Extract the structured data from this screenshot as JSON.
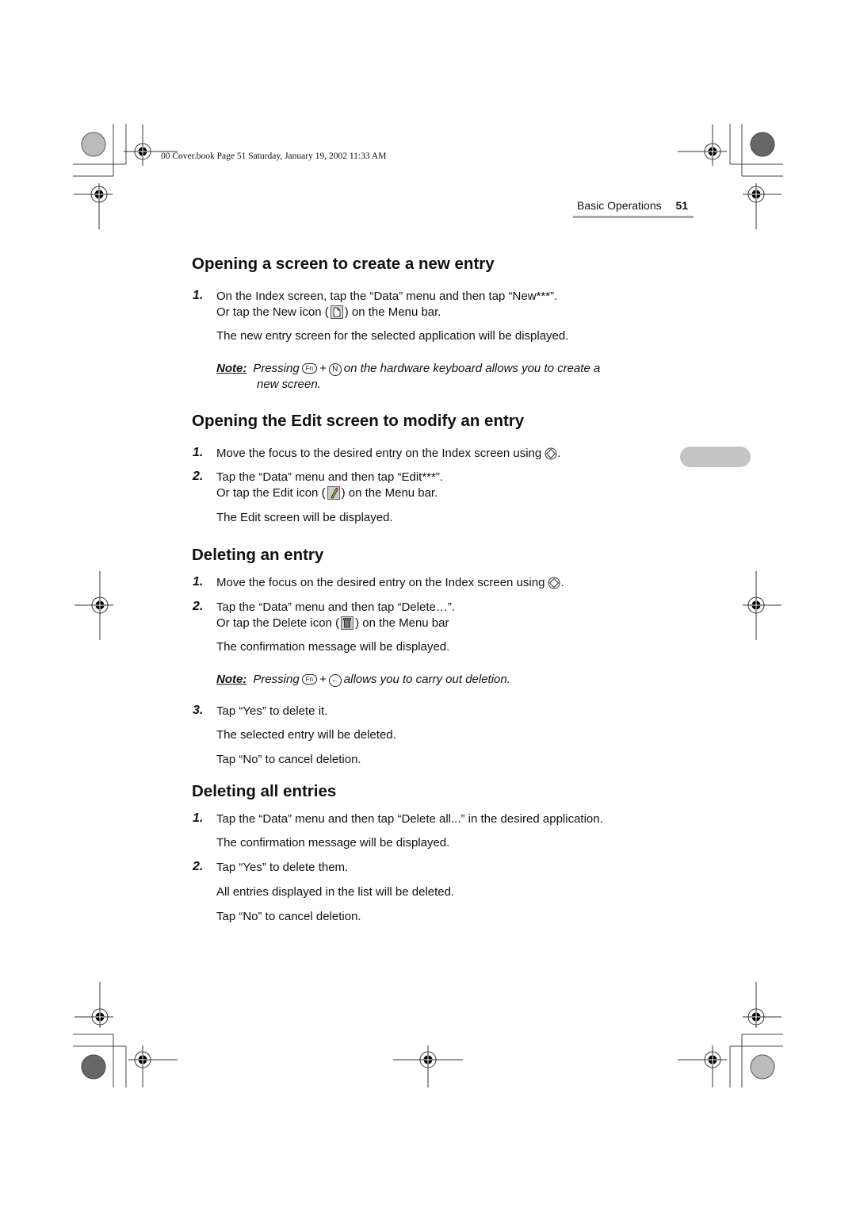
{
  "slug": "00 Cover.book  Page 51  Saturday, January 19, 2002  11:33 AM",
  "running_head": {
    "title": "Basic Operations",
    "page_number": "51"
  },
  "sections": [
    {
      "heading": "Opening a screen to create a new entry",
      "steps": [
        {
          "num": "1.",
          "line1": "On the Index screen, tap the “Data” menu and then tap “New***”.",
          "line2_before": "Or tap the New icon (",
          "line2_after": ") on the Menu bar.",
          "icon": "new-document-icon"
        }
      ],
      "result": "The new entry screen for the selected application will be displayed.",
      "note": {
        "label": "Note:",
        "before": "Pressing",
        "key1": "Fn",
        "plus": "+",
        "key2": "N",
        "after": "on the hardware keyboard allows you to create a",
        "cont": "new screen."
      }
    },
    {
      "heading": "Opening the Edit screen to modify an entry",
      "steps": [
        {
          "num": "1.",
          "line1": "Move the focus to the desired entry on the Index screen using",
          "end": "."
        },
        {
          "num": "2.",
          "line1": "Tap the “Data” menu and then tap “Edit***”.",
          "line2_before": "Or tap the Edit icon (",
          "line2_after": ") on the Menu bar.",
          "icon": "edit-pencil-icon"
        }
      ],
      "result": "The Edit screen will be displayed."
    },
    {
      "heading": "Deleting an entry",
      "steps": [
        {
          "num": "1.",
          "line1": "Move the focus on the desired entry on the Index screen using",
          "end": "."
        },
        {
          "num": "2.",
          "line1": "Tap the “Data” menu and then tap “Delete…”.",
          "line2_before": "Or tap the Delete icon (",
          "line2_after": ") on the Menu bar",
          "icon": "trash-icon"
        },
        {
          "num": "3.",
          "line1": "Tap “Yes” to delete it."
        }
      ],
      "result": "The confirmation message will be displayed.",
      "note": {
        "label": "Note:",
        "before": "Pressing",
        "key1": "Fn",
        "plus": "+",
        "after": "allows you to carry out deletion."
      },
      "after_step3": [
        "The selected entry will be deleted.",
        "Tap “No” to cancel deletion."
      ]
    },
    {
      "heading": "Deleting all entries",
      "steps": [
        {
          "num": "1.",
          "line1": "Tap the “Data” menu and then tap “Delete all...” in the desired application."
        },
        {
          "num": "2.",
          "line1": "Tap “Yes” to delete them."
        }
      ],
      "after_step1": "The confirmation message will be displayed.",
      "after_step2": [
        "All entries displayed in the list will be deleted.",
        "Tap “No” to cancel deletion."
      ]
    }
  ]
}
